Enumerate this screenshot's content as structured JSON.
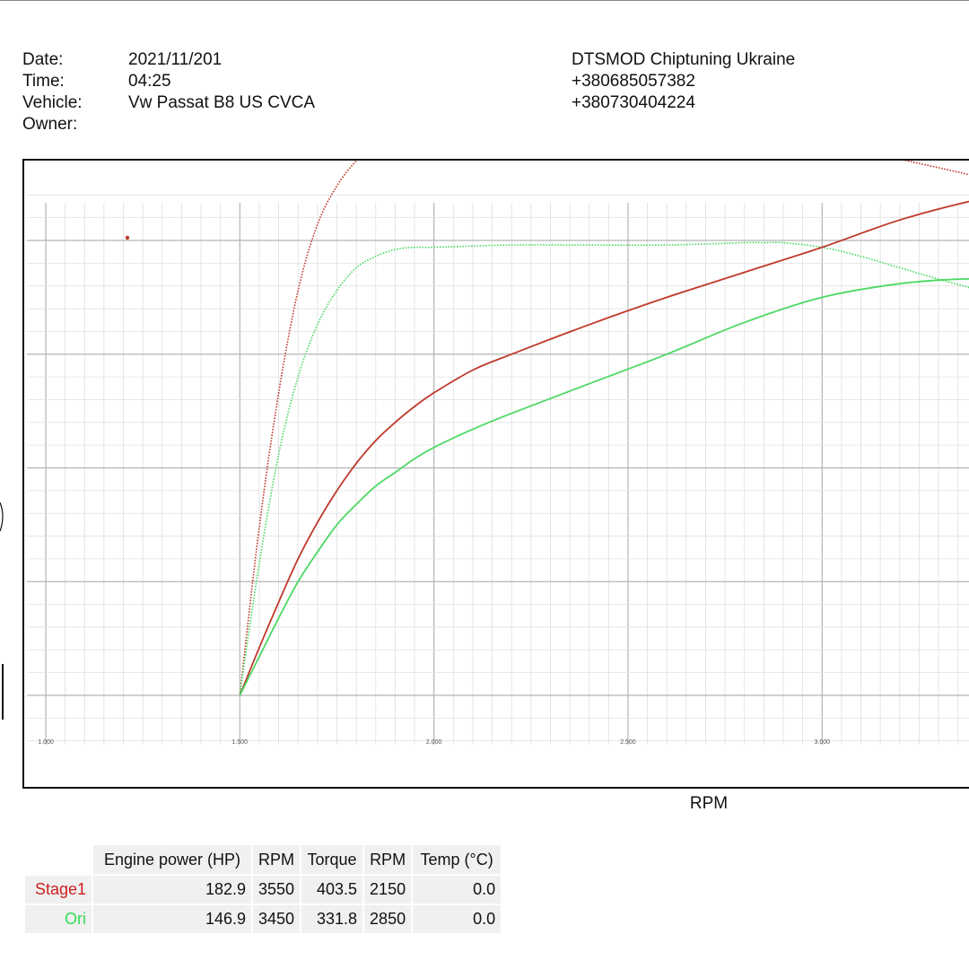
{
  "header": {
    "date_label": "Date:",
    "date_value": "2021/11/201",
    "time_label": "Time:",
    "time_value": "04:25",
    "vehicle_label": "Vehicle:",
    "vehicle_value": "Vw Passat B8 US CVCA",
    "owner_label": "Owner:",
    "company": "DTSMOD Chiptuning Ukraine",
    "phone1": "+380685057382",
    "phone2": "+380730404224"
  },
  "colors": {
    "stage1": "#c0392b",
    "ori": "#4cd964",
    "grid": "#c8c8c8"
  },
  "chart_data": {
    "type": "line",
    "xlabel": "RPM",
    "ylabel": "",
    "title": "",
    "x_ticks": [
      "1.000",
      "1.500",
      "2.000",
      "2.500",
      "3.000"
    ],
    "xlim": [
      1000,
      3500
    ],
    "ylim": [
      0,
      200
    ],
    "series": [
      {
        "name": "Stage1",
        "kind": "torque",
        "style": "dotted",
        "color": "#c0392b",
        "x": [
          1500,
          1550,
          1600,
          1650,
          1700,
          1750,
          1800,
          1850,
          1900,
          1950,
          2000,
          2100,
          2150,
          2200,
          2300,
          2500,
          2700,
          2900,
          3100,
          3300,
          3450
        ],
        "y": [
          0,
          74,
          133,
          178,
          207,
          224,
          235,
          242,
          247,
          250,
          251,
          252,
          252,
          252,
          251,
          249,
          246,
          243,
          239,
          232,
          226
        ]
      },
      {
        "name": "Ori",
        "kind": "torque",
        "style": "dotted",
        "color": "#4cd964",
        "x": [
          1500,
          1550,
          1600,
          1650,
          1700,
          1750,
          1800,
          1850,
          1900,
          1950,
          2000,
          2200,
          2400,
          2600,
          2800,
          2850,
          2900,
          3000,
          3100,
          3200,
          3300,
          3450
        ],
        "y": [
          0,
          58,
          106,
          140,
          163,
          178,
          188,
          193,
          196,
          197,
          197,
          198,
          198,
          198,
          199,
          199,
          199,
          197,
          193,
          188,
          183,
          176
        ]
      },
      {
        "name": "Stage1",
        "kind": "power",
        "style": "solid",
        "color": "#c0392b",
        "x": [
          1500,
          1550,
          1600,
          1650,
          1700,
          1750,
          1800,
          1850,
          1900,
          1950,
          2000,
          2100,
          2200,
          2400,
          2600,
          2800,
          3000,
          3200,
          3400,
          3450
        ],
        "y": [
          0,
          21,
          41,
          60,
          76,
          90,
          102,
          112,
          120,
          127,
          133,
          143,
          150,
          163,
          175,
          186,
          197,
          209,
          218,
          219
        ]
      },
      {
        "name": "Ori",
        "kind": "power",
        "style": "solid",
        "color": "#4cd964",
        "x": [
          1500,
          1550,
          1600,
          1650,
          1700,
          1750,
          1800,
          1850,
          1900,
          1950,
          2000,
          2100,
          2200,
          2400,
          2600,
          2800,
          3000,
          3200,
          3350,
          3450
        ],
        "y": [
          0,
          17,
          34,
          50,
          63,
          75,
          84,
          92,
          98,
          104,
          109,
          117,
          124,
          137,
          150,
          164,
          175,
          181,
          183,
          183
        ]
      }
    ]
  },
  "results": {
    "headers": [
      "Engine power (HP)",
      "RPM",
      "Torque",
      "RPM",
      "Temp (°C)"
    ],
    "rows": [
      {
        "name": "Stage1",
        "values": [
          "182.9",
          "3550",
          "403.5",
          "2150",
          "0.0"
        ]
      },
      {
        "name": "Ori",
        "values": [
          "146.9",
          "3450",
          "331.8",
          "2850",
          "0.0"
        ]
      }
    ]
  }
}
